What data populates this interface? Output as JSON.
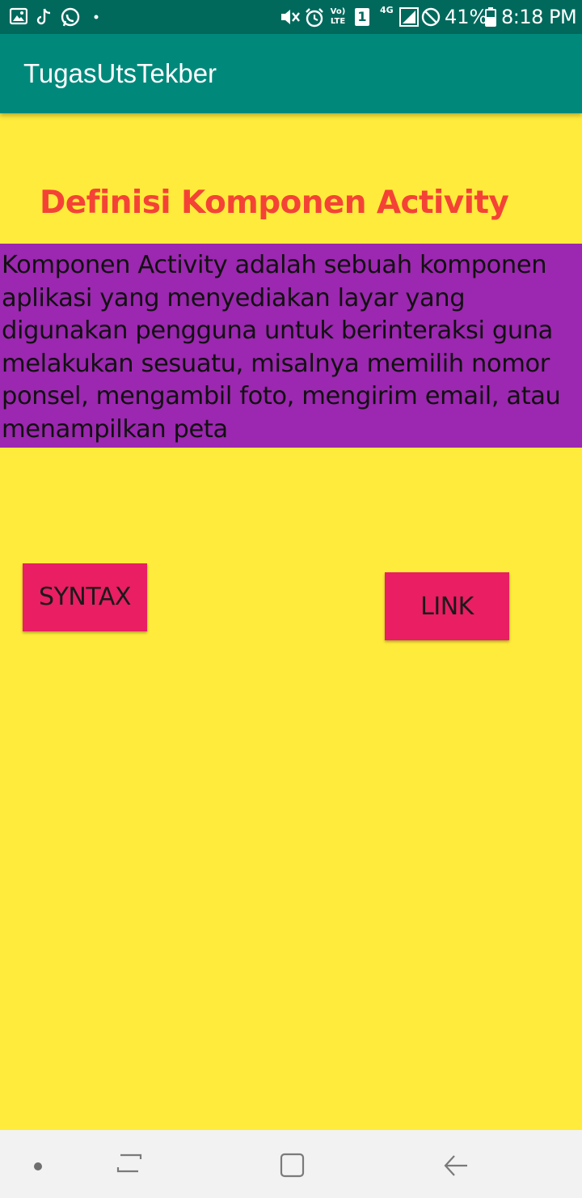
{
  "status_bar": {
    "battery_percent": "41%",
    "time": "8:18 PM",
    "network_label": "4G",
    "sim_label": "1",
    "volte_label": "Vo) LTE",
    "icons": [
      "gallery-icon",
      "tiktok-icon",
      "whatsapp-icon",
      "dot-icon",
      "mute-icon",
      "alarm-icon",
      "volte-icon",
      "sim-icon",
      "signal-icon",
      "no-disturb-icon",
      "battery-icon"
    ]
  },
  "app_bar": {
    "title": "TugasUtsTekber"
  },
  "main": {
    "heading": "Definisi Komponen Activity",
    "description": "Komponen Activity adalah sebuah komponen aplikasi yang menyediakan layar yang digunakan pengguna untuk berinteraksi guna melakukan sesuatu, misalnya memilih nomor ponsel, mengambil foto, mengirim email, atau menampilkan peta",
    "buttons": {
      "syntax": "SYNTAX",
      "link": "LINK"
    }
  },
  "nav_bar": {
    "icons": [
      "dot-icon",
      "recents-icon",
      "home-icon",
      "back-icon"
    ]
  },
  "colors": {
    "background": "#ffeb3b",
    "status_bar": "#00695c",
    "app_bar": "#00897b",
    "heading": "#f44336",
    "description_bg": "#9c27b0",
    "button": "#e91e63"
  }
}
